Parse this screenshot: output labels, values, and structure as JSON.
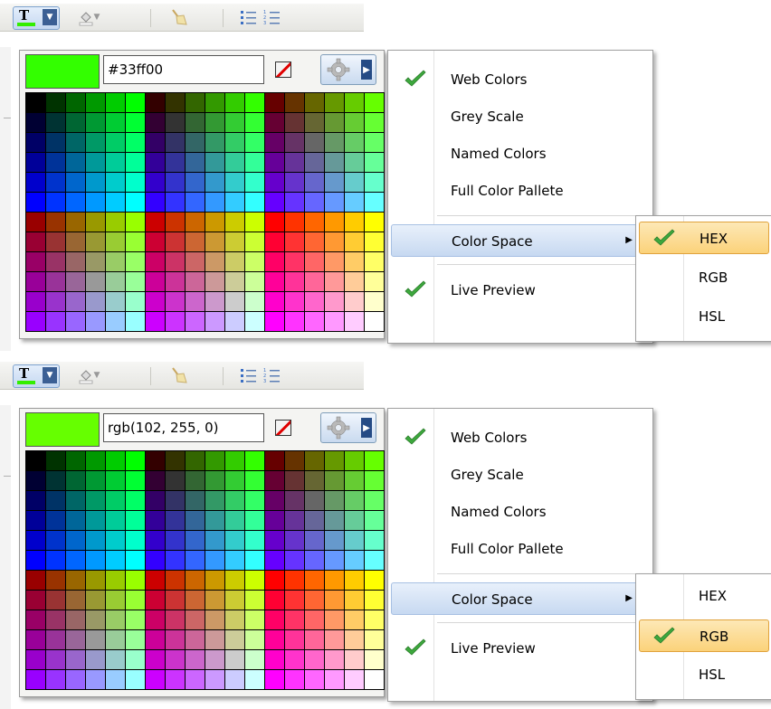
{
  "colors": {
    "swatch": "#33ff00",
    "swatch_rgb": "#66ff00",
    "accent_check": "#3da83d",
    "selection": "#fbd27a"
  },
  "panels": [
    {
      "color_value": "#33ff00",
      "menu": {
        "items": [
          {
            "label": "Web Colors",
            "checked": true
          },
          {
            "label": "Grey Scale",
            "checked": false
          },
          {
            "label": "Named Colors",
            "checked": false
          },
          {
            "label": "Full Color Pallete",
            "checked": false
          },
          {
            "label": "Color Space",
            "checked": false,
            "has_submenu": true
          },
          {
            "label": "Live Preview",
            "checked": true
          }
        ]
      },
      "submenu": {
        "items": [
          {
            "label": "HEX",
            "checked": true
          },
          {
            "label": "RGB",
            "checked": false
          },
          {
            "label": "HSL",
            "checked": false
          }
        ]
      }
    },
    {
      "color_value": "rgb(102, 255, 0)",
      "menu": {
        "items": [
          {
            "label": "Web Colors",
            "checked": true
          },
          {
            "label": "Grey Scale",
            "checked": false
          },
          {
            "label": "Named Colors",
            "checked": false
          },
          {
            "label": "Full Color Pallete",
            "checked": false
          },
          {
            "label": "Color Space",
            "checked": false,
            "has_submenu": true
          },
          {
            "label": "Live Preview",
            "checked": true
          }
        ]
      },
      "submenu": {
        "items": [
          {
            "label": "HEX",
            "checked": false
          },
          {
            "label": "RGB",
            "checked": true
          },
          {
            "label": "HSL",
            "checked": false
          }
        ]
      }
    }
  ],
  "icons": {
    "text_color": "text-color-icon",
    "fill_color": "fill-bucket-icon",
    "clear": "broom-icon",
    "bullet_list": "bullet-list-icon",
    "numbered_list": "numbered-list-icon",
    "no_color": "no-color-icon",
    "settings": "gear-icon",
    "check": "checkmark-icon"
  },
  "palette": {
    "type": "web-safe-216",
    "rows": 12,
    "columns": 18
  }
}
